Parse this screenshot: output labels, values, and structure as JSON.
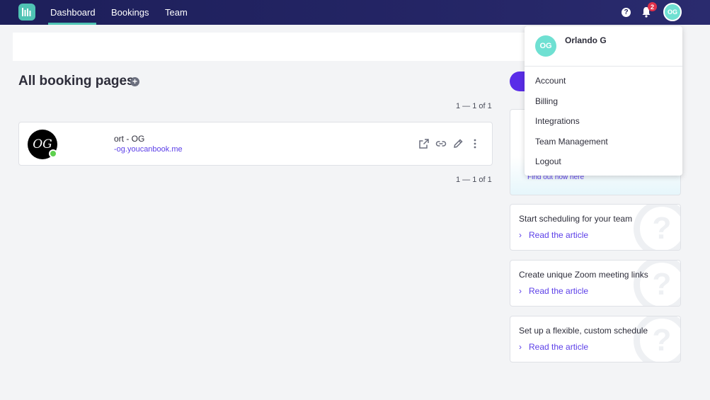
{
  "nav": {
    "items": [
      {
        "label": "Dashboard",
        "active": true
      },
      {
        "label": "Bookings"
      },
      {
        "label": "Team"
      }
    ],
    "notification_count": "2",
    "avatar_initials": "OG",
    "help_glyph": "?"
  },
  "main": {
    "title": "All booking pages",
    "pager_top": "1 — 1 of 1",
    "pager_bottom": "1 — 1 of 1",
    "booking": {
      "avatar_text": "OG",
      "name": "ort - OG",
      "url": "-og.youcanbook.me"
    }
  },
  "tips": {
    "big_link": "Find out how here",
    "cards": [
      {
        "title": "Start scheduling for your team",
        "link": "Read the article"
      },
      {
        "title": "Create unique Zoom meeting links",
        "link": "Read the article"
      },
      {
        "title": "Set up a flexible, custom schedule",
        "link": "Read the article"
      }
    ]
  },
  "dropdown": {
    "avatar_initials": "OG",
    "user_name": "Orlando G",
    "items": [
      "Account",
      "Billing",
      "Integrations",
      "Team Management",
      "Logout"
    ]
  },
  "colors": {
    "nav_bg": "#1d1f5a",
    "accent_teal": "#4fc3b4",
    "link_purple": "#5b3ee8",
    "badge_red": "#e0314b",
    "status_green": "#5ed04e"
  }
}
